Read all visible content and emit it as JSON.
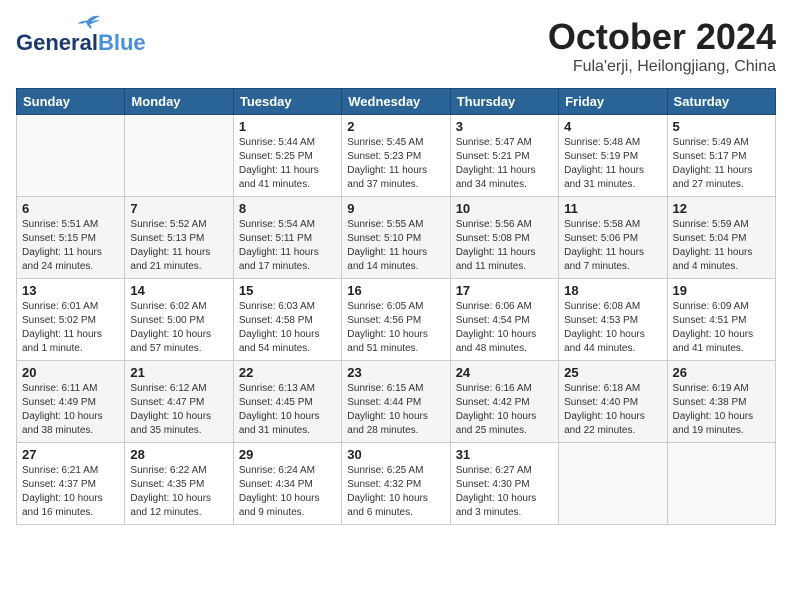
{
  "header": {
    "logo_general": "General",
    "logo_blue": "Blue",
    "month": "October 2024",
    "location": "Fula'erji, Heilongjiang, China"
  },
  "weekdays": [
    "Sunday",
    "Monday",
    "Tuesday",
    "Wednesday",
    "Thursday",
    "Friday",
    "Saturday"
  ],
  "weeks": [
    [
      {
        "day": "",
        "info": ""
      },
      {
        "day": "",
        "info": ""
      },
      {
        "day": "1",
        "info": "Sunrise: 5:44 AM\nSunset: 5:25 PM\nDaylight: 11 hours and 41 minutes."
      },
      {
        "day": "2",
        "info": "Sunrise: 5:45 AM\nSunset: 5:23 PM\nDaylight: 11 hours and 37 minutes."
      },
      {
        "day": "3",
        "info": "Sunrise: 5:47 AM\nSunset: 5:21 PM\nDaylight: 11 hours and 34 minutes."
      },
      {
        "day": "4",
        "info": "Sunrise: 5:48 AM\nSunset: 5:19 PM\nDaylight: 11 hours and 31 minutes."
      },
      {
        "day": "5",
        "info": "Sunrise: 5:49 AM\nSunset: 5:17 PM\nDaylight: 11 hours and 27 minutes."
      }
    ],
    [
      {
        "day": "6",
        "info": "Sunrise: 5:51 AM\nSunset: 5:15 PM\nDaylight: 11 hours and 24 minutes."
      },
      {
        "day": "7",
        "info": "Sunrise: 5:52 AM\nSunset: 5:13 PM\nDaylight: 11 hours and 21 minutes."
      },
      {
        "day": "8",
        "info": "Sunrise: 5:54 AM\nSunset: 5:11 PM\nDaylight: 11 hours and 17 minutes."
      },
      {
        "day": "9",
        "info": "Sunrise: 5:55 AM\nSunset: 5:10 PM\nDaylight: 11 hours and 14 minutes."
      },
      {
        "day": "10",
        "info": "Sunrise: 5:56 AM\nSunset: 5:08 PM\nDaylight: 11 hours and 11 minutes."
      },
      {
        "day": "11",
        "info": "Sunrise: 5:58 AM\nSunset: 5:06 PM\nDaylight: 11 hours and 7 minutes."
      },
      {
        "day": "12",
        "info": "Sunrise: 5:59 AM\nSunset: 5:04 PM\nDaylight: 11 hours and 4 minutes."
      }
    ],
    [
      {
        "day": "13",
        "info": "Sunrise: 6:01 AM\nSunset: 5:02 PM\nDaylight: 11 hours and 1 minute."
      },
      {
        "day": "14",
        "info": "Sunrise: 6:02 AM\nSunset: 5:00 PM\nDaylight: 10 hours and 57 minutes."
      },
      {
        "day": "15",
        "info": "Sunrise: 6:03 AM\nSunset: 4:58 PM\nDaylight: 10 hours and 54 minutes."
      },
      {
        "day": "16",
        "info": "Sunrise: 6:05 AM\nSunset: 4:56 PM\nDaylight: 10 hours and 51 minutes."
      },
      {
        "day": "17",
        "info": "Sunrise: 6:06 AM\nSunset: 4:54 PM\nDaylight: 10 hours and 48 minutes."
      },
      {
        "day": "18",
        "info": "Sunrise: 6:08 AM\nSunset: 4:53 PM\nDaylight: 10 hours and 44 minutes."
      },
      {
        "day": "19",
        "info": "Sunrise: 6:09 AM\nSunset: 4:51 PM\nDaylight: 10 hours and 41 minutes."
      }
    ],
    [
      {
        "day": "20",
        "info": "Sunrise: 6:11 AM\nSunset: 4:49 PM\nDaylight: 10 hours and 38 minutes."
      },
      {
        "day": "21",
        "info": "Sunrise: 6:12 AM\nSunset: 4:47 PM\nDaylight: 10 hours and 35 minutes."
      },
      {
        "day": "22",
        "info": "Sunrise: 6:13 AM\nSunset: 4:45 PM\nDaylight: 10 hours and 31 minutes."
      },
      {
        "day": "23",
        "info": "Sunrise: 6:15 AM\nSunset: 4:44 PM\nDaylight: 10 hours and 28 minutes."
      },
      {
        "day": "24",
        "info": "Sunrise: 6:16 AM\nSunset: 4:42 PM\nDaylight: 10 hours and 25 minutes."
      },
      {
        "day": "25",
        "info": "Sunrise: 6:18 AM\nSunset: 4:40 PM\nDaylight: 10 hours and 22 minutes."
      },
      {
        "day": "26",
        "info": "Sunrise: 6:19 AM\nSunset: 4:38 PM\nDaylight: 10 hours and 19 minutes."
      }
    ],
    [
      {
        "day": "27",
        "info": "Sunrise: 6:21 AM\nSunset: 4:37 PM\nDaylight: 10 hours and 16 minutes."
      },
      {
        "day": "28",
        "info": "Sunrise: 6:22 AM\nSunset: 4:35 PM\nDaylight: 10 hours and 12 minutes."
      },
      {
        "day": "29",
        "info": "Sunrise: 6:24 AM\nSunset: 4:34 PM\nDaylight: 10 hours and 9 minutes."
      },
      {
        "day": "30",
        "info": "Sunrise: 6:25 AM\nSunset: 4:32 PM\nDaylight: 10 hours and 6 minutes."
      },
      {
        "day": "31",
        "info": "Sunrise: 6:27 AM\nSunset: 4:30 PM\nDaylight: 10 hours and 3 minutes."
      },
      {
        "day": "",
        "info": ""
      },
      {
        "day": "",
        "info": ""
      }
    ]
  ]
}
